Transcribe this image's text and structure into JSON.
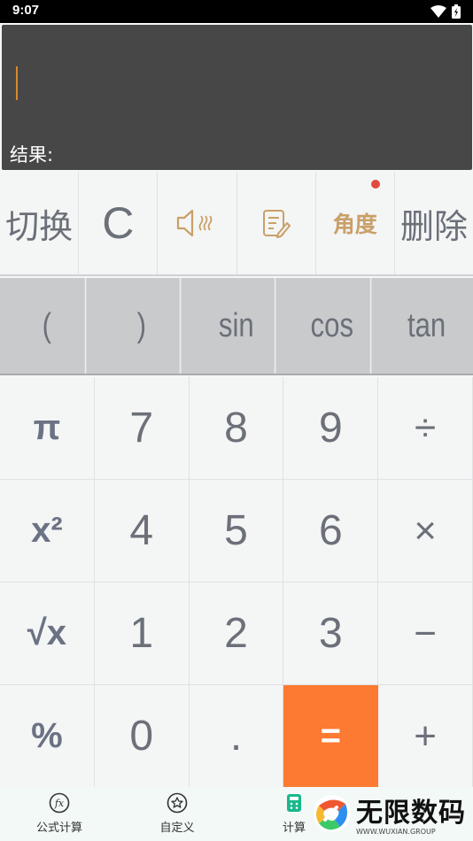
{
  "status_bar": {
    "time": "9:07"
  },
  "display": {
    "result_label": "结果:"
  },
  "toolbar": {
    "switch_label": "切换",
    "clear_label": "C",
    "angle_label": "角度",
    "delete_label": "删除"
  },
  "functions": [
    "(",
    ")",
    "sin",
    "cos",
    "tan"
  ],
  "keypad": {
    "rows": [
      [
        "π",
        "7",
        "8",
        "9",
        "÷"
      ],
      [
        "x²",
        "4",
        "5",
        "6",
        "×"
      ],
      [
        "√x",
        "1",
        "2",
        "3",
        "−"
      ],
      [
        "%",
        "0",
        ".",
        "=",
        "+"
      ]
    ]
  },
  "bottom_nav": {
    "items": [
      {
        "label": "公式计算",
        "icon": "fx-icon"
      },
      {
        "label": "自定义",
        "icon": "star-badge-icon"
      },
      {
        "label": "计算",
        "icon": "calculator-icon"
      }
    ]
  },
  "watermark": {
    "text": "无限数码",
    "sub": "WWW.WUXIAN.GROUP"
  },
  "colors": {
    "accent": "#fd7a32",
    "display_bg": "#474747",
    "cursor": "#d88a2e",
    "angle": "#c9a068",
    "badge": "#e24a3f"
  }
}
